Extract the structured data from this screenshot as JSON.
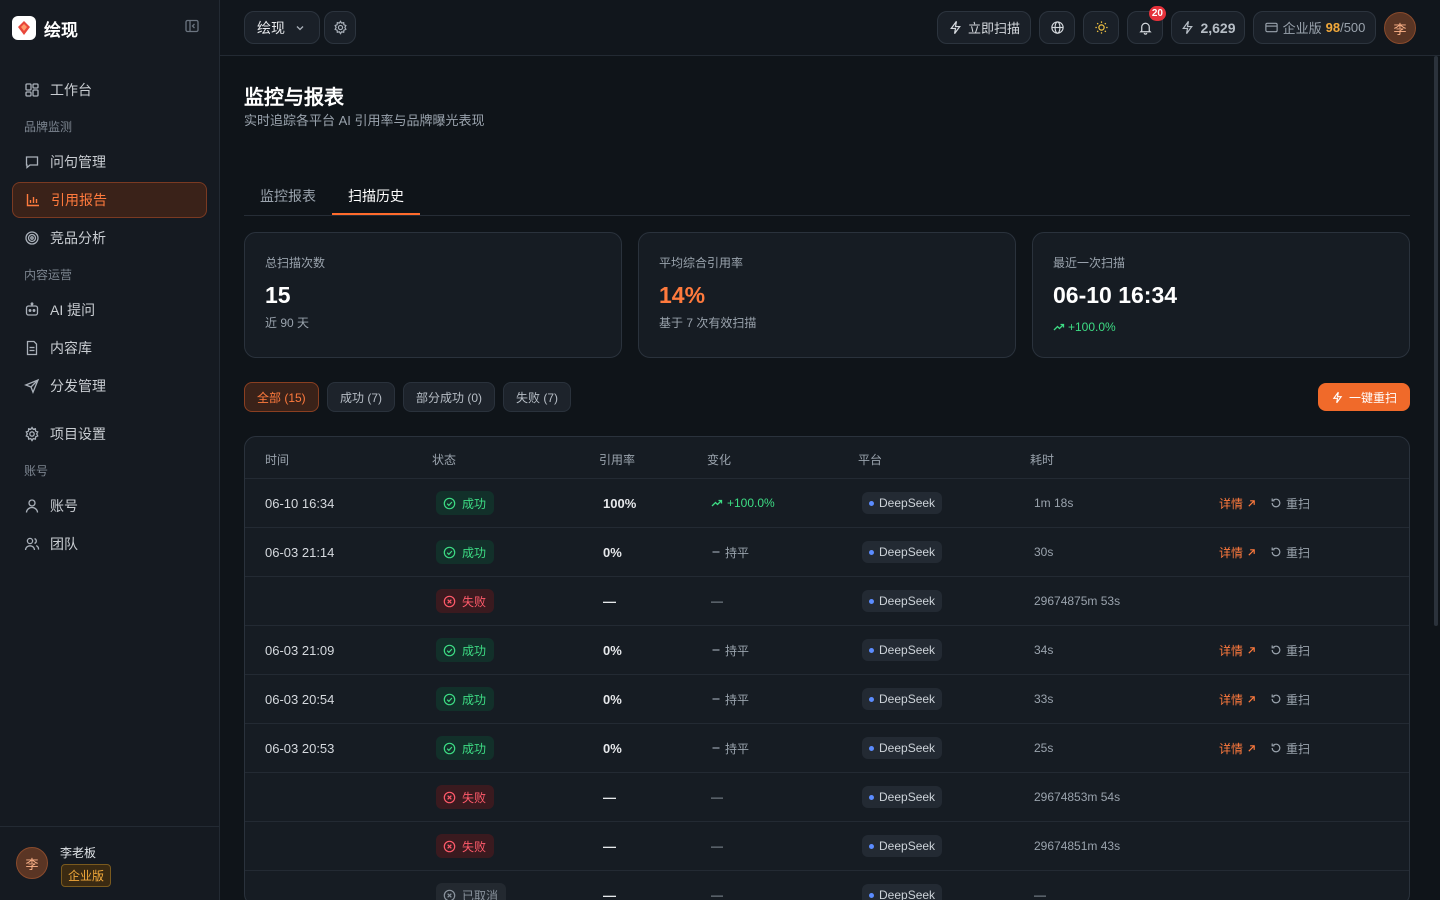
{
  "app": {
    "name": "绘现"
  },
  "sidebar": {
    "items": [
      {
        "type": "item",
        "label": "工作台",
        "icon": "dashboard-icon",
        "active": false
      },
      {
        "type": "group",
        "label": "品牌监测"
      },
      {
        "type": "item",
        "label": "问句管理",
        "icon": "message-icon",
        "active": false
      },
      {
        "type": "item",
        "label": "引用报告",
        "icon": "bar-chart-icon",
        "active": true
      },
      {
        "type": "item",
        "label": "竞品分析",
        "icon": "target-icon",
        "active": false
      },
      {
        "type": "group",
        "label": "内容运营"
      },
      {
        "type": "item",
        "label": "AI 提问",
        "icon": "sparkle-icon",
        "active": false
      },
      {
        "type": "item",
        "label": "内容库",
        "icon": "document-icon",
        "active": false
      },
      {
        "type": "item",
        "label": "分发管理",
        "icon": "send-icon",
        "active": false
      },
      {
        "type": "gap"
      },
      {
        "type": "item",
        "label": "项目设置",
        "icon": "gear-icon",
        "active": false
      },
      {
        "type": "group",
        "label": "账号"
      },
      {
        "type": "item",
        "label": "账号",
        "icon": "user-icon",
        "active": false
      },
      {
        "type": "item",
        "label": "团队",
        "icon": "users-icon",
        "active": false
      }
    ],
    "user": {
      "avatar": "李",
      "name": "李老板",
      "plan": "企业版"
    }
  },
  "topbar": {
    "project": "绘现",
    "scan_now": "立即扫描",
    "notifications": "20",
    "credits": "2,629",
    "plan_prefix": "企业版",
    "plan_used": "98",
    "plan_total": "/500",
    "avatar": "李"
  },
  "page": {
    "title": "监控与报表",
    "subtitle": "实时追踪各平台 AI 引用率与品牌曝光表现"
  },
  "tabs": [
    {
      "label": "监控报表",
      "active": false
    },
    {
      "label": "扫描历史",
      "active": true
    }
  ],
  "stats": {
    "total_label": "总扫描次数",
    "total_value": "15",
    "total_note": "近 90 天",
    "avg_label": "平均综合引用率",
    "avg_value": "14%",
    "avg_note": "基于 7 次有效扫描",
    "last_label": "最近一次扫描",
    "last_value": "06-10 16:34",
    "last_change": "+100.0%"
  },
  "filters": [
    {
      "label": "全部 (15)",
      "active": true
    },
    {
      "label": "成功 (7)",
      "active": false
    },
    {
      "label": "部分成功 (0)",
      "active": false
    },
    {
      "label": "失败 (7)",
      "active": false
    }
  ],
  "rescan_all": "一键重扫",
  "table": {
    "headers": [
      "时间",
      "状态",
      "引用率",
      "变化",
      "平台",
      "耗时"
    ],
    "detail_label": "详情",
    "rescan_label": "重扫",
    "rows": [
      {
        "time": "06-10 16:34",
        "status": "成功",
        "status_type": "success",
        "rate": "100%",
        "change": "+100.0%",
        "change_type": "up",
        "platform": "DeepSeek",
        "duration": "1m 18s",
        "actions": true
      },
      {
        "time": "06-03 21:14",
        "status": "成功",
        "status_type": "success",
        "rate": "0%",
        "change": "持平",
        "change_type": "flat",
        "platform": "DeepSeek",
        "duration": "30s",
        "actions": true
      },
      {
        "time": "",
        "status": "失败",
        "status_type": "failed",
        "rate": "—",
        "change": "—",
        "change_type": "none",
        "platform": "DeepSeek",
        "duration": "29674875m 53s",
        "actions": false
      },
      {
        "time": "06-03 21:09",
        "status": "成功",
        "status_type": "success",
        "rate": "0%",
        "change": "持平",
        "change_type": "flat",
        "platform": "DeepSeek",
        "duration": "34s",
        "actions": true
      },
      {
        "time": "06-03 20:54",
        "status": "成功",
        "status_type": "success",
        "rate": "0%",
        "change": "持平",
        "change_type": "flat",
        "platform": "DeepSeek",
        "duration": "33s",
        "actions": true
      },
      {
        "time": "06-03 20:53",
        "status": "成功",
        "status_type": "success",
        "rate": "0%",
        "change": "持平",
        "change_type": "flat",
        "platform": "DeepSeek",
        "duration": "25s",
        "actions": true
      },
      {
        "time": "",
        "status": "失败",
        "status_type": "failed",
        "rate": "—",
        "change": "—",
        "change_type": "none",
        "platform": "DeepSeek",
        "duration": "29674853m 54s",
        "actions": false
      },
      {
        "time": "",
        "status": "失败",
        "status_type": "failed",
        "rate": "—",
        "change": "—",
        "change_type": "none",
        "platform": "DeepSeek",
        "duration": "29674851m 43s",
        "actions": false
      },
      {
        "time": "",
        "status": "已取消",
        "status_type": "cancelled",
        "rate": "—",
        "change": "—",
        "change_type": "none",
        "platform": "DeepSeek",
        "duration": "—",
        "actions": false
      }
    ]
  },
  "colors": {
    "accent": "#ff6b2c",
    "success": "#3ddc84",
    "danger": "#ff5a6a",
    "platform_dot": "#5b8cff"
  }
}
